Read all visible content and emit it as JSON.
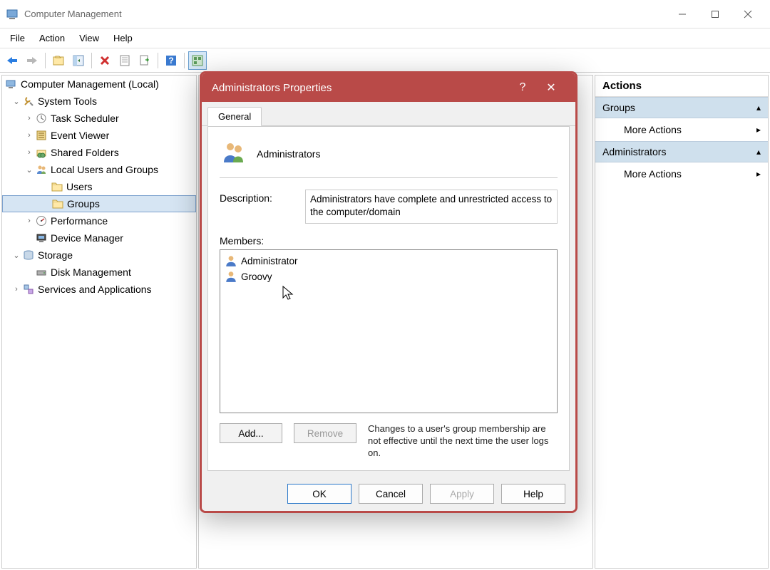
{
  "window": {
    "title": "Computer Management"
  },
  "menu": {
    "file": "File",
    "action": "Action",
    "view": "View",
    "help": "Help"
  },
  "tree": {
    "root": "Computer Management (Local)",
    "system_tools": "System Tools",
    "task_scheduler": "Task Scheduler",
    "event_viewer": "Event Viewer",
    "shared_folders": "Shared Folders",
    "local_users_groups": "Local Users and Groups",
    "users": "Users",
    "groups": "Groups",
    "performance": "Performance",
    "device_manager": "Device Manager",
    "storage": "Storage",
    "disk_management": "Disk Management",
    "services_apps": "Services and Applications"
  },
  "actions": {
    "header": "Actions",
    "section1": "Groups",
    "more1": "More Actions",
    "section2": "Administrators",
    "more2": "More Actions"
  },
  "dialog": {
    "title": "Administrators Properties",
    "tab_general": "General",
    "group_name": "Administrators",
    "description_label": "Description:",
    "description_value": "Administrators have complete and unrestricted access to the computer/domain",
    "members_label": "Members:",
    "members": [
      {
        "name": "Administrator"
      },
      {
        "name": "Groovy"
      }
    ],
    "add_btn": "Add...",
    "remove_btn": "Remove",
    "footer_note": "Changes to a user's group membership are not effective until the next time the user logs on.",
    "ok_btn": "OK",
    "cancel_btn": "Cancel",
    "apply_btn": "Apply",
    "help_btn": "Help"
  }
}
